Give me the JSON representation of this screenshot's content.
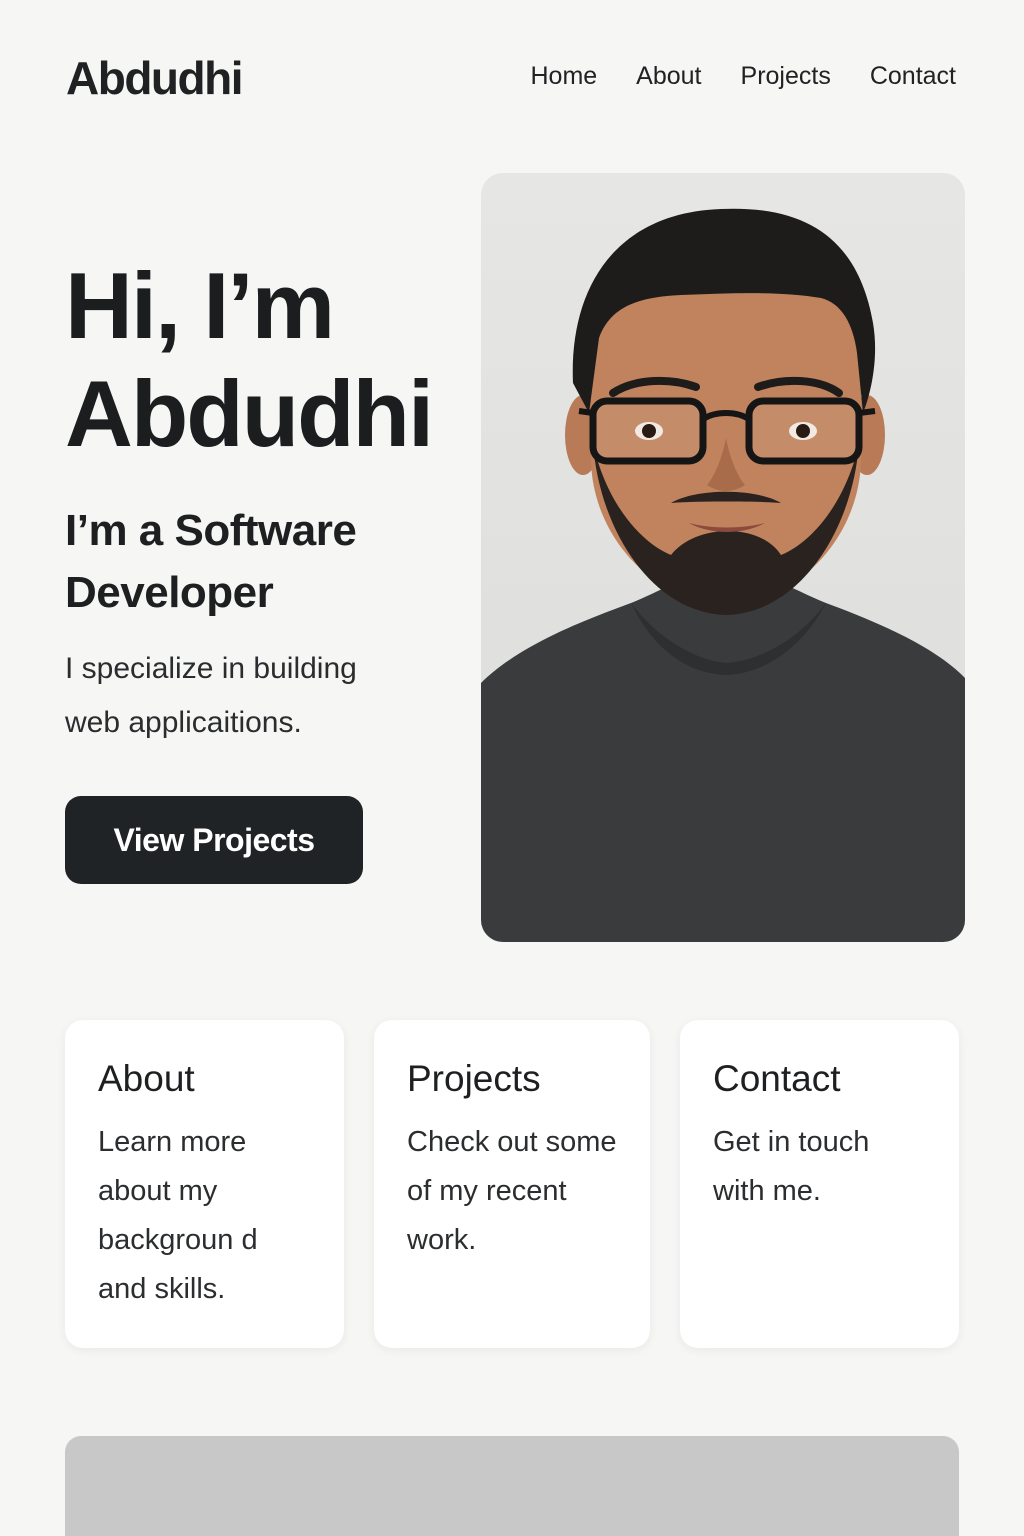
{
  "header": {
    "logo": "Abdudhi",
    "nav": [
      {
        "label": "Home"
      },
      {
        "label": "About"
      },
      {
        "label": "Projects"
      },
      {
        "label": "Contact"
      }
    ]
  },
  "hero": {
    "greeting_line1": "Hi, I’m",
    "greeting_line2": "Abdudhi",
    "role": "I’m a Software Developer",
    "description": "I specialize in building web applicaitions.",
    "cta_label": "View Projects"
  },
  "cards": [
    {
      "title": "About",
      "text": "Learn more about my backgroun d and skills."
    },
    {
      "title": "Projects",
      "text": "Check out some of my recent work."
    },
    {
      "title": "Contact",
      "text": "Get in touch with me."
    }
  ],
  "colors": {
    "background": "#f6f6f5",
    "text": "#1d1f20",
    "button": "#1f2325",
    "card": "#ffffff",
    "bottom_block": "#c8c8c8"
  }
}
